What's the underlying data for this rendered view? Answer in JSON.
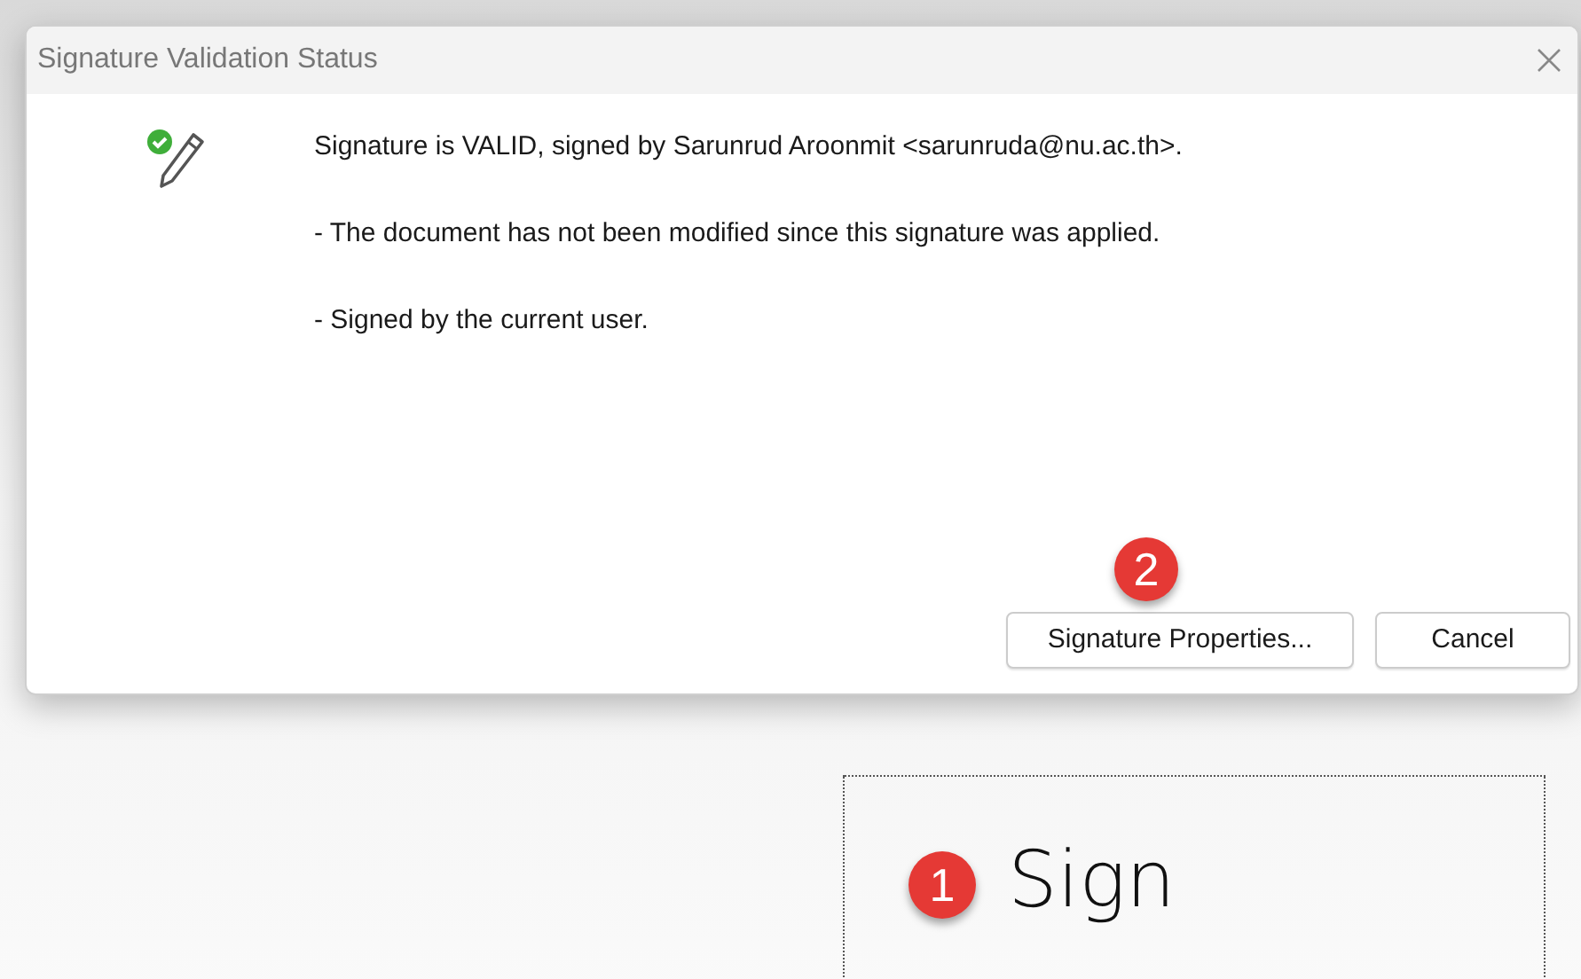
{
  "window": {
    "title": "Signature Validation Status"
  },
  "status": {
    "valid": true,
    "messages": [
      "Signature is VALID, signed by Sarunrud Aroonmit <sarunruda@nu.ac.th>.",
      "- The document has not been modified since this signature was applied.",
      "- Signed by the current user."
    ]
  },
  "buttons": [
    {
      "label": "Signature Properties...",
      "callout": "2"
    },
    {
      "label": "Cancel"
    }
  ],
  "signature_field": {
    "text": "Sign",
    "callout": "1"
  }
}
